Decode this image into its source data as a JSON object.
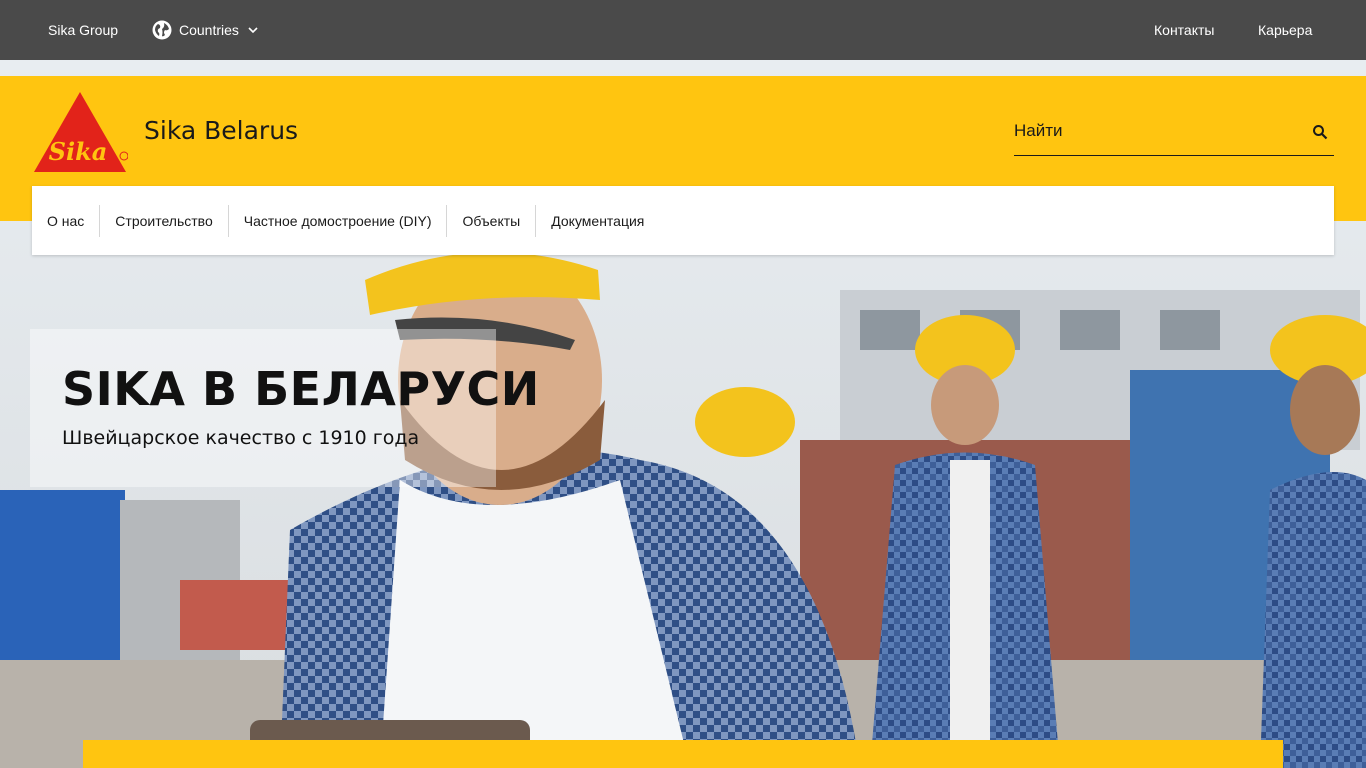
{
  "topbar": {
    "group_label": "Sika Group",
    "countries_label": "Countries",
    "contacts_label": "Контакты",
    "career_label": "Карьера"
  },
  "header": {
    "brand_name": "Sika",
    "site_title": "Sika Belarus",
    "search_placeholder": "Найти"
  },
  "nav": {
    "items": [
      {
        "label": "О нас"
      },
      {
        "label": "Строительство"
      },
      {
        "label": "Частное домостроение (DIY)"
      },
      {
        "label": "Объекты"
      },
      {
        "label": "Документация"
      }
    ]
  },
  "hero": {
    "title": "SIKA В БЕЛАРУСИ",
    "subtitle": "Швейцарское качество с 1910 года"
  },
  "colors": {
    "topbar_bg": "#4a4a4a",
    "brand_yellow": "#ffc510",
    "brand_red": "#e2231a",
    "nav_bg": "#ffffff"
  }
}
